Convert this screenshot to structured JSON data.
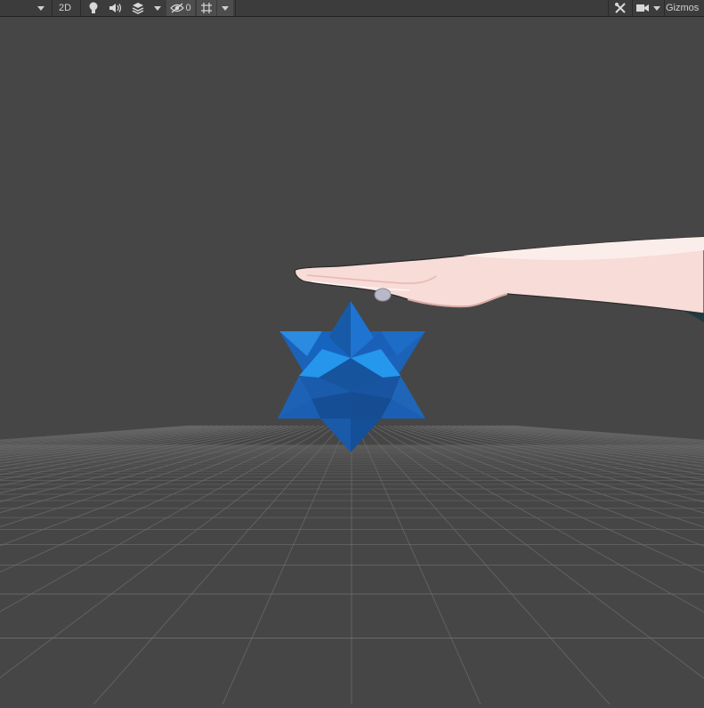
{
  "toolbar": {
    "mode_2d_label": "2D",
    "hidden_count": "0",
    "gizmos_label": "Gizmos",
    "icons": [
      "dropdown-arrow-icon",
      "lighting-bulb-icon",
      "audio-speaker-icon",
      "effects-layers-icon",
      "dropdown-arrow-icon",
      "scene-visibility-icon",
      "grid-icon",
      "dropdown-arrow-icon",
      "tools-icon",
      "camera-icon",
      "dropdown-arrow-icon"
    ]
  },
  "scene": {
    "background_color": "#464646",
    "grid_color": "#6a6a6a",
    "objects": [
      {
        "name": "star-tetrahedron",
        "color": "#1f78d6"
      },
      {
        "name": "hand",
        "color": "#f6dcd8"
      }
    ]
  }
}
